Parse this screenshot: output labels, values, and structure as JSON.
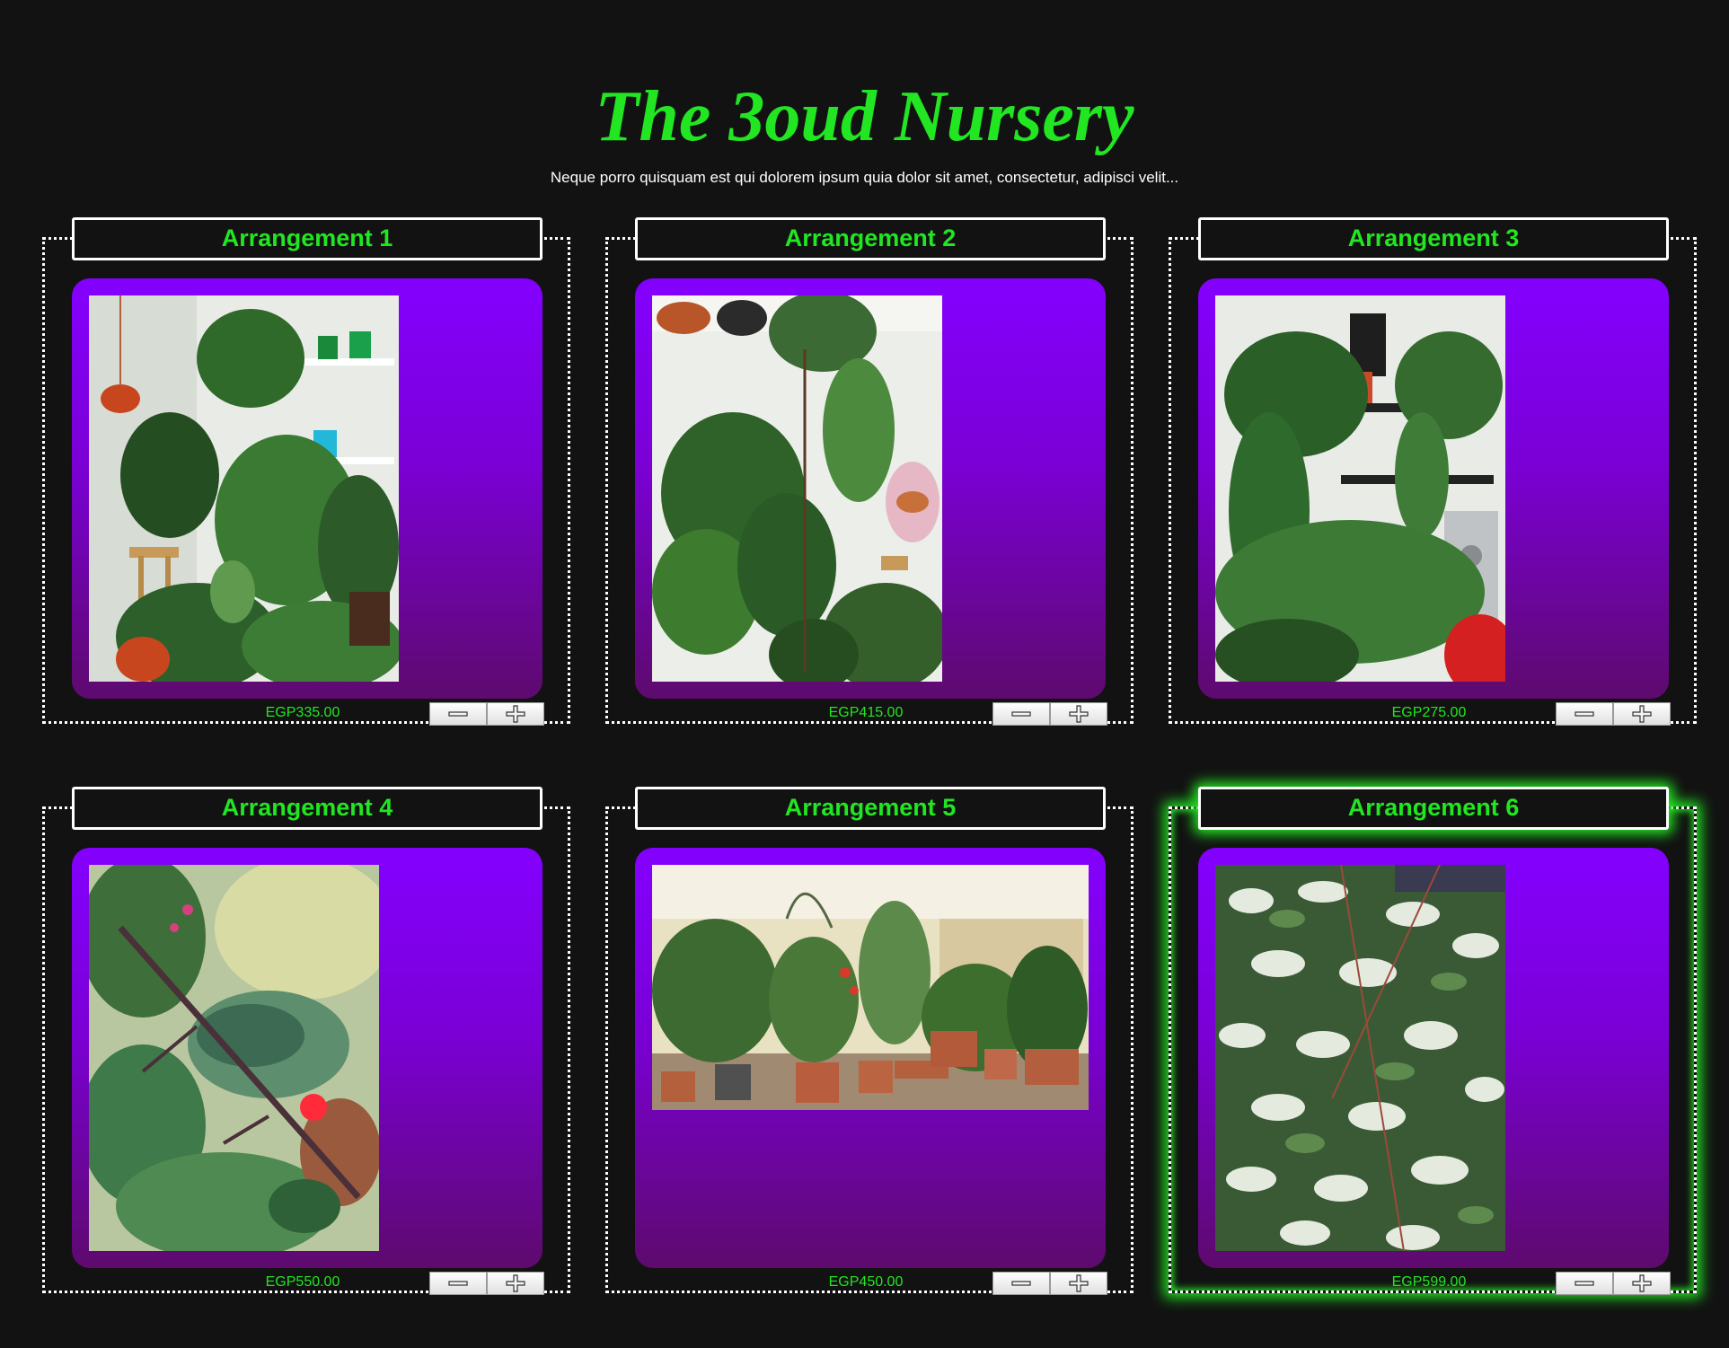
{
  "header": {
    "title": "The 3oud Nursery",
    "subtitle": "Neque porro quisquam est qui dolorem ipsum quia dolor sit amet, consectetur, adipisci velit..."
  },
  "colors": {
    "background": "#121212",
    "accent_green": "#22e622",
    "panel_top": "#8400ff",
    "panel_bottom": "#5e0a6e",
    "border": "#ffffff"
  },
  "products": [
    {
      "name": "Arrangement 1",
      "price": "EGP335.00",
      "image": "indoor-hanging-plants-photo",
      "decrement_icon": "minus-icon",
      "increment_icon": "plus-icon"
    },
    {
      "name": "Arrangement 2",
      "price": "EGP415.00",
      "image": "fiddle-leaf-corner-photo",
      "decrement_icon": "minus-icon",
      "increment_icon": "plus-icon"
    },
    {
      "name": "Arrangement 3",
      "price": "EGP275.00",
      "image": "pothos-shelf-photo",
      "decrement_icon": "minus-icon",
      "increment_icon": "plus-icon"
    },
    {
      "name": "Arrangement 4",
      "price": "EGP550.00",
      "image": "bougainvillea-closeup-photo",
      "decrement_icon": "minus-icon",
      "increment_icon": "plus-icon"
    },
    {
      "name": "Arrangement 5",
      "price": "EGP450.00",
      "image": "rooftop-pots-photo",
      "decrement_icon": "minus-icon",
      "increment_icon": "plus-icon"
    },
    {
      "name": "Arrangement 6",
      "price": "EGP599.00",
      "image": "variegated-shrub-photo",
      "decrement_icon": "minus-icon",
      "increment_icon": "plus-icon",
      "highlighted": true
    }
  ]
}
